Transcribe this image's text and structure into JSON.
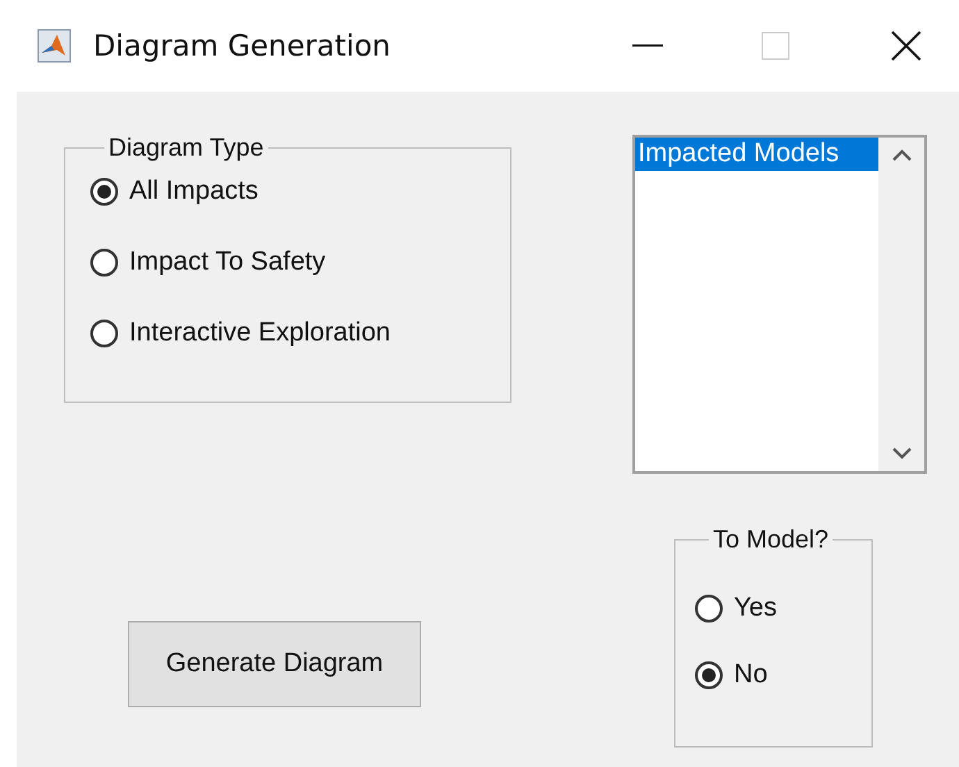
{
  "window": {
    "title": "Diagram Generation"
  },
  "diagram_type": {
    "label": "Diagram Type",
    "options": [
      {
        "label": "All Impacts",
        "selected": true
      },
      {
        "label": "Impact To Safety",
        "selected": false
      },
      {
        "label": "Interactive Exploration",
        "selected": false
      }
    ]
  },
  "list": {
    "items": [
      {
        "label": "Impacted Models",
        "selected": true
      }
    ]
  },
  "generate_button": {
    "label": "Generate Diagram"
  },
  "to_model": {
    "label": "To Model?",
    "options": [
      {
        "label": "Yes",
        "selected": false
      },
      {
        "label": "No",
        "selected": true
      }
    ]
  }
}
